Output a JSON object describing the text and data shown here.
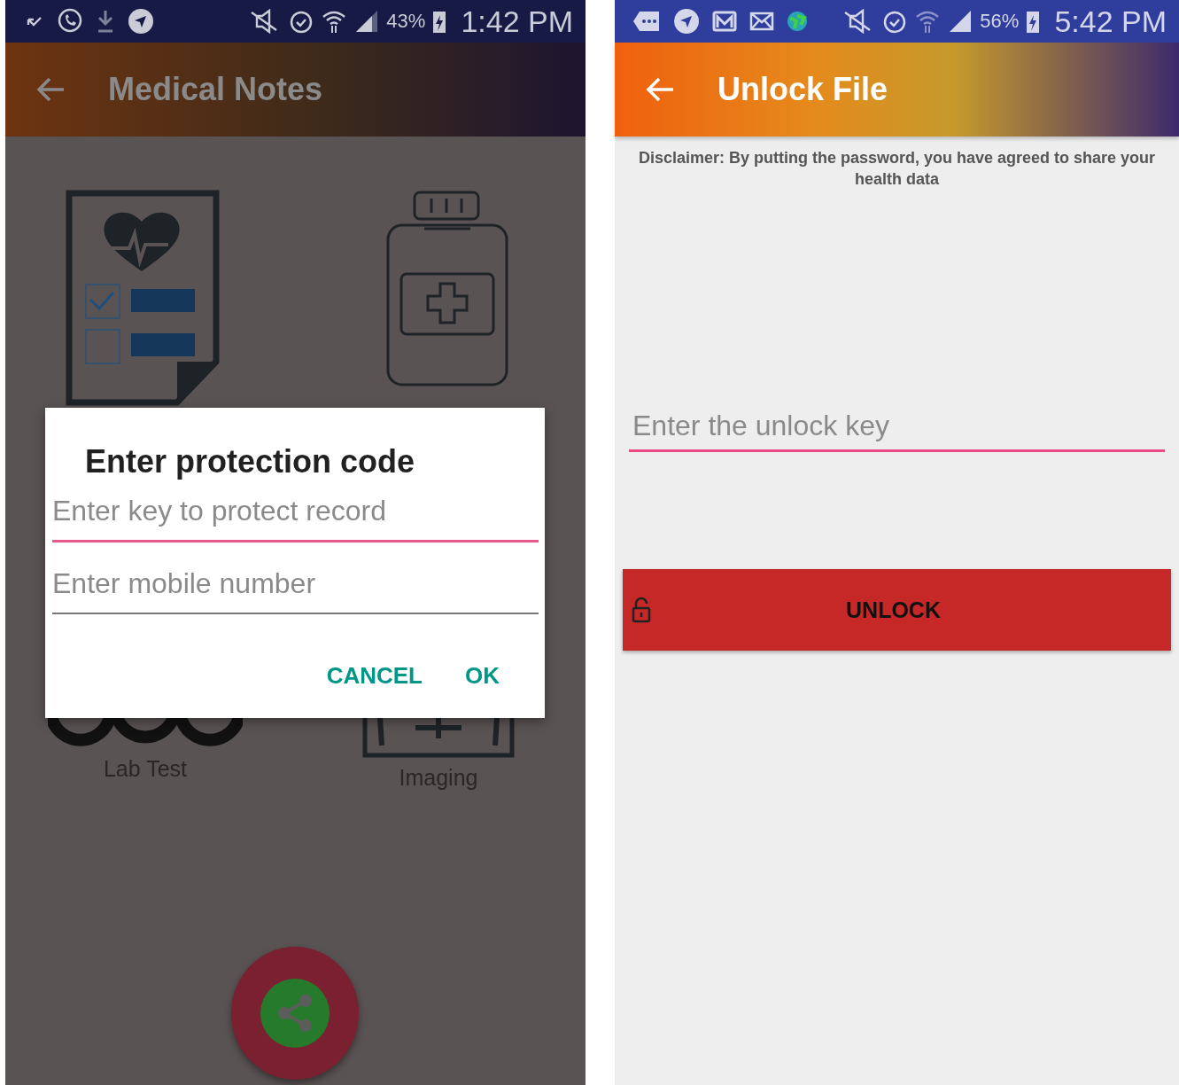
{
  "left_screen": {
    "status_bar": {
      "battery": "43%",
      "time": "1:42 PM"
    },
    "app_bar": {
      "title": "Medical Notes"
    },
    "tiles": [
      {
        "label": "Lab Test"
      },
      {
        "label": "Imaging"
      }
    ],
    "dialog": {
      "title": "Enter protection code",
      "fields": [
        {
          "placeholder": "Enter key to protect record",
          "focused": true
        },
        {
          "placeholder": "Enter mobile number",
          "focused": false
        }
      ],
      "buttons": [
        "CANCEL",
        "OK"
      ]
    }
  },
  "right_screen": {
    "status_bar": {
      "battery": "56%",
      "time": "5:42 PM"
    },
    "app_bar": {
      "title": "Unlock File"
    },
    "disclaimer": "Disclaimer: By putting the password, you have agreed to share your health data",
    "field": {
      "placeholder": "Enter the unlock key",
      "focused": true
    },
    "button": "UNLOCK"
  }
}
